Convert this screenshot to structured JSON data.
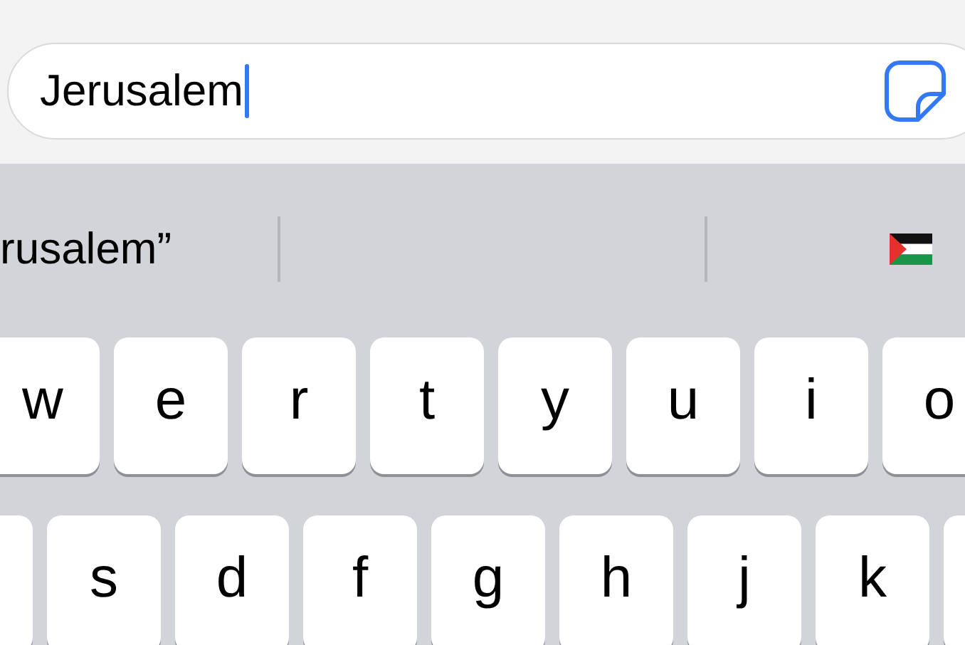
{
  "search_field": {
    "value": "Jerusalem"
  },
  "suggestion": "rusalem”",
  "key_rows": [
    [
      {
        "kind": "letter",
        "label": "w"
      },
      {
        "kind": "letter",
        "label": "e"
      },
      {
        "kind": "letter",
        "label": "r"
      },
      {
        "kind": "letter",
        "label": "t"
      },
      {
        "kind": "letter",
        "label": "y"
      },
      {
        "kind": "letter",
        "label": "u"
      },
      {
        "kind": "letter",
        "label": "i"
      },
      {
        "kind": "letter",
        "label": "o"
      }
    ],
    [
      {
        "kind": "blank"
      },
      {
        "kind": "letter",
        "label": "s"
      },
      {
        "kind": "letter",
        "label": "d"
      },
      {
        "kind": "letter",
        "label": "f"
      },
      {
        "kind": "letter",
        "label": "g"
      },
      {
        "kind": "letter",
        "label": "h"
      },
      {
        "kind": "letter",
        "label": "j"
      },
      {
        "kind": "letter",
        "label": "k"
      },
      {
        "kind": "blank"
      }
    ]
  ]
}
